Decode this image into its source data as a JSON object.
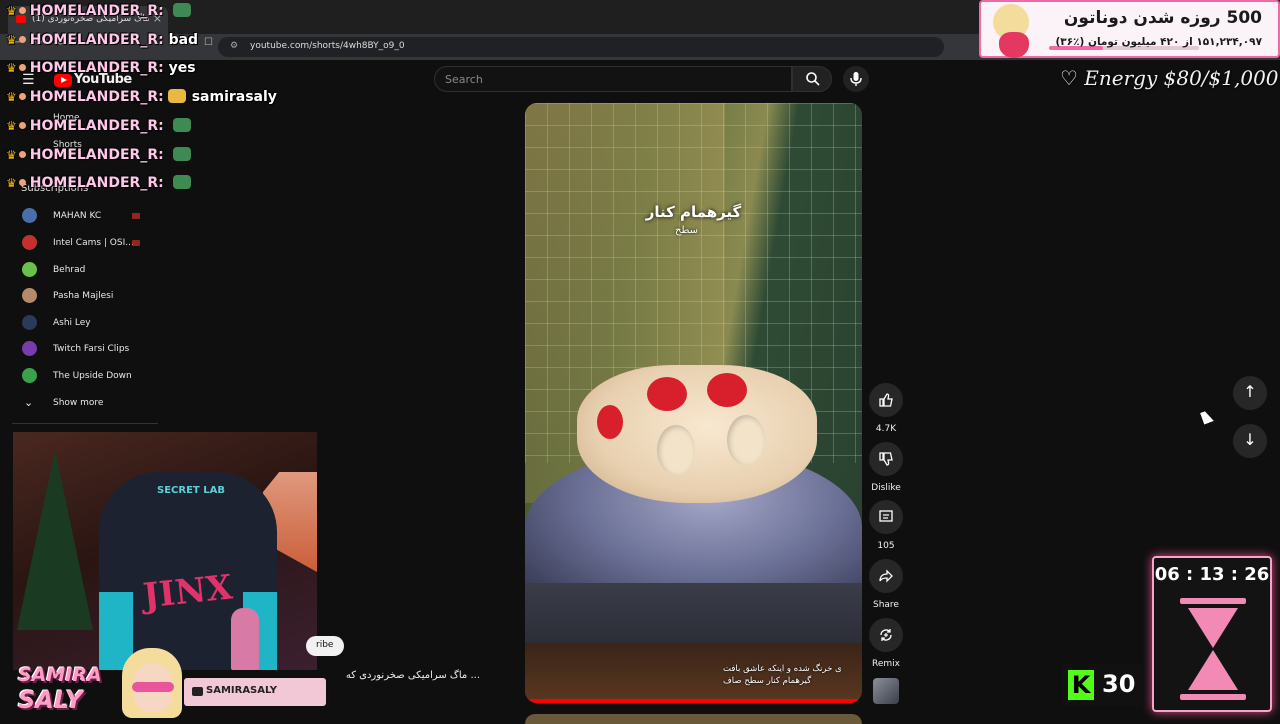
{
  "browser": {
    "tab_title": "(1) ماگ سرامیکی صخره‌نوردی",
    "url": "youtube.com/shorts/4wh8BY_o9_0"
  },
  "youtube": {
    "logo_text": "YouTube",
    "search_placeholder": "Search",
    "nav": {
      "home": "Home",
      "shorts": "Shorts",
      "subscriptions": "Subscriptions"
    },
    "subscriptions": [
      {
        "name": "MAHAN KC",
        "color": "#4a6ea8",
        "live": true
      },
      {
        "name": "Intel Cams | OSI...",
        "color": "#c4302b",
        "live": true
      },
      {
        "name": "Behrad",
        "color": "#6ac04a",
        "live": false
      },
      {
        "name": "Pasha Majlesi",
        "color": "#b58a6a",
        "live": false
      },
      {
        "name": "Ashi Ley",
        "color": "#2a3a5a",
        "live": false
      },
      {
        "name": "Twitch Farsi Clips",
        "color": "#7a3ab0",
        "live": false
      },
      {
        "name": "The Upside Down",
        "color": "#3aa04a",
        "live": false
      }
    ],
    "show_more": "Show more",
    "subscribe_partial": "ribe",
    "video_title_left": "... ماگ سرامیکی صخرنوردی که",
    "video": {
      "overlay_title": "گیرهمام کنار",
      "overlay_subtitle": "سطح",
      "caption_line1": "ی خرنگ شده و اینکه عاشق بافت",
      "caption_line2": "گیرهمام کنار سطح صاف"
    },
    "actions": {
      "like_count": "4.7K",
      "dislike_label": "Dislike",
      "comment_count": "105",
      "share_label": "Share",
      "remix_label": "Remix"
    }
  },
  "chat": [
    {
      "user": "HOMELANDER_R:",
      "message": "",
      "emote": true
    },
    {
      "user": "HOMELANDER_R:",
      "message": "bad",
      "emote": false
    },
    {
      "user": "HOMELANDER_R:",
      "message": "yes",
      "emote": false
    },
    {
      "user": "HOMELANDER_R:",
      "message": "samirasaly",
      "emote": true
    },
    {
      "user": "HOMELANDER_R:",
      "message": "",
      "emote": true
    },
    {
      "user": "HOMELANDER_R:",
      "message": "",
      "emote": true
    },
    {
      "user": "HOMELANDER_R:",
      "message": "",
      "emote": true
    }
  ],
  "webcam": {
    "chair_brand": "SECRET LAB",
    "chair_text": "JINX"
  },
  "streamer": {
    "logo_line1": "SAMIRA",
    "logo_line2": "SALY",
    "handle": "SAMIRASALY"
  },
  "donation": {
    "title": "500 روزه شدن دوناتون",
    "progress_text": "۱۵۱,۲۳۴,۰۹۷ از ۴۲۰ میلیون تومان (٪۳۶)",
    "progress_fraction": 0.36
  },
  "energy": "♡ Energy $80/$1,000",
  "timer": "06 : 13 : 26",
  "kick": {
    "icon": "K",
    "count": "30"
  },
  "colors": {
    "accent": "#ff0000",
    "pink": "#f06aa5",
    "kick_green": "#53fc18"
  }
}
